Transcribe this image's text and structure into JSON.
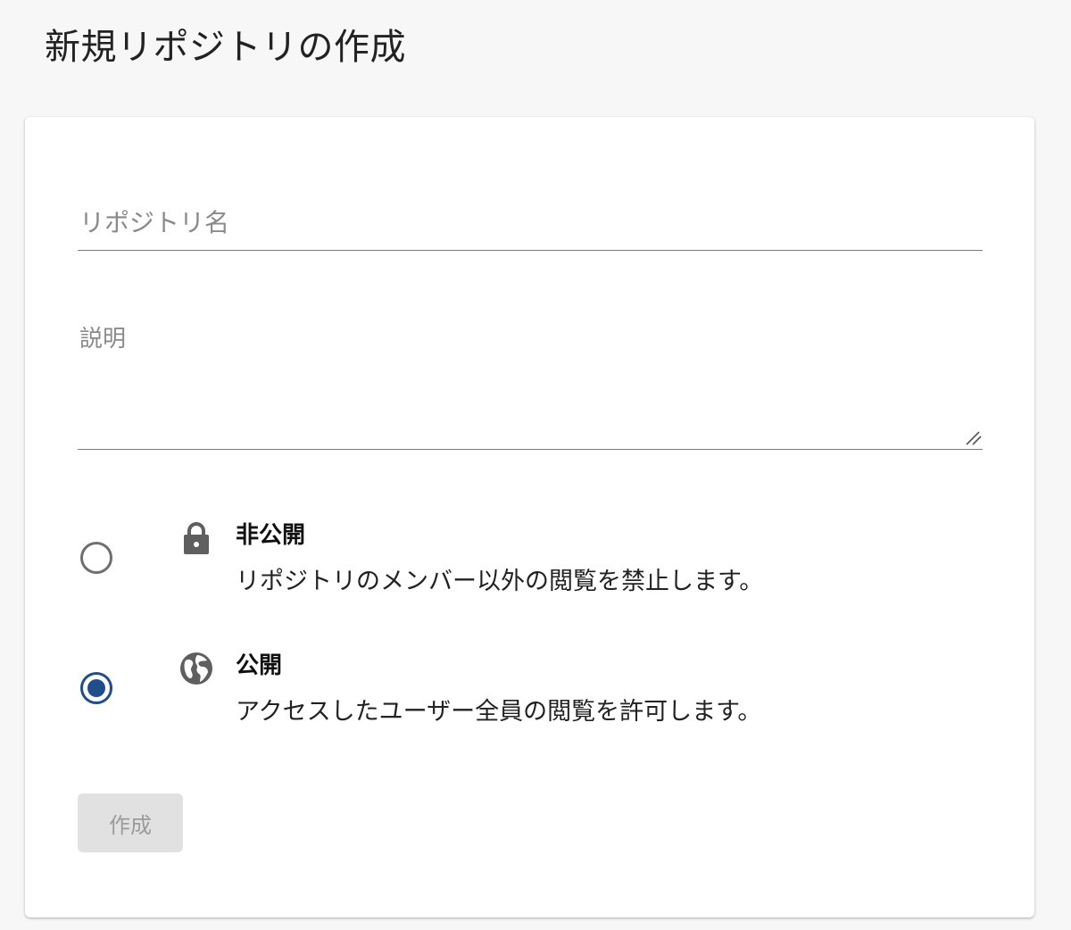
{
  "page": {
    "title": "新規リポジトリの作成"
  },
  "form": {
    "name_field": {
      "value": "",
      "placeholder": "リポジトリ名"
    },
    "description_field": {
      "value": "",
      "placeholder": "説明"
    },
    "visibility": {
      "selected": "public",
      "options": [
        {
          "id": "private",
          "icon": "lock-icon",
          "label": "非公開",
          "description": "リポジトリのメンバー以外の閲覧を禁止します。"
        },
        {
          "id": "public",
          "icon": "globe-icon",
          "label": "公開",
          "description": "アクセスしたユーザー全員の閲覧を許可します。"
        }
      ]
    },
    "submit": {
      "label": "作成",
      "disabled": true
    }
  },
  "colors": {
    "accent": "#1f4e8a",
    "radio_unselected": "#6f6f6f",
    "disabled_bg": "#e1e1e1",
    "disabled_text": "#9b9b9b",
    "page_bg": "#f7f7f7",
    "card_bg": "#ffffff"
  }
}
